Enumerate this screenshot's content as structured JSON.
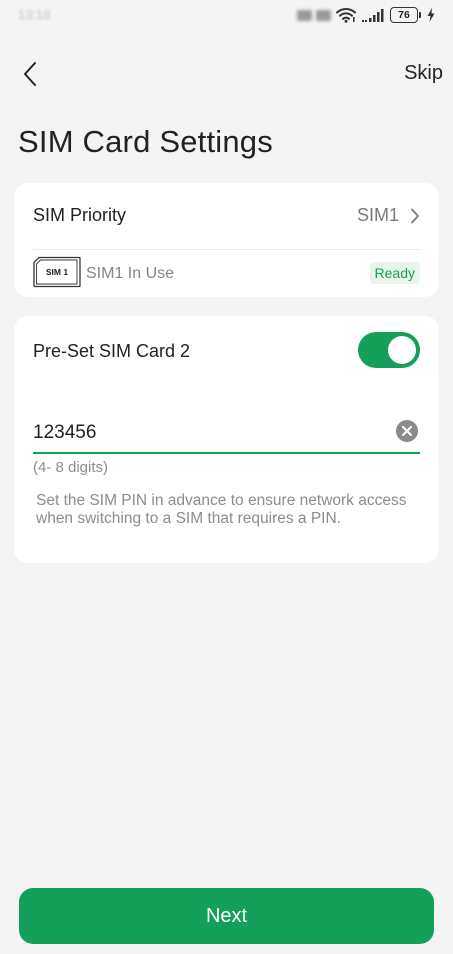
{
  "status_bar": {
    "time": "13:18",
    "battery_level": "76"
  },
  "header": {
    "skip_label": "Skip",
    "title": "SIM Card Settings"
  },
  "sim_priority": {
    "label": "SIM Priority",
    "value": "SIM1",
    "chip_label": "SIM 1",
    "in_use_text": "SIM1 In Use",
    "status_badge": "Ready"
  },
  "preset_sim2": {
    "label": "Pre-Set SIM Card 2",
    "toggle_on": true,
    "pin_value": "123456",
    "pin_hint": "(4- 8 digits)",
    "description": "Set the SIM PIN in advance to ensure network access when switching to a SIM that requires a PIN."
  },
  "footer": {
    "next_label": "Next"
  },
  "colors": {
    "accent": "#14a05a",
    "badge_bg": "#e7f5ec",
    "background": "#f4f4f4"
  }
}
